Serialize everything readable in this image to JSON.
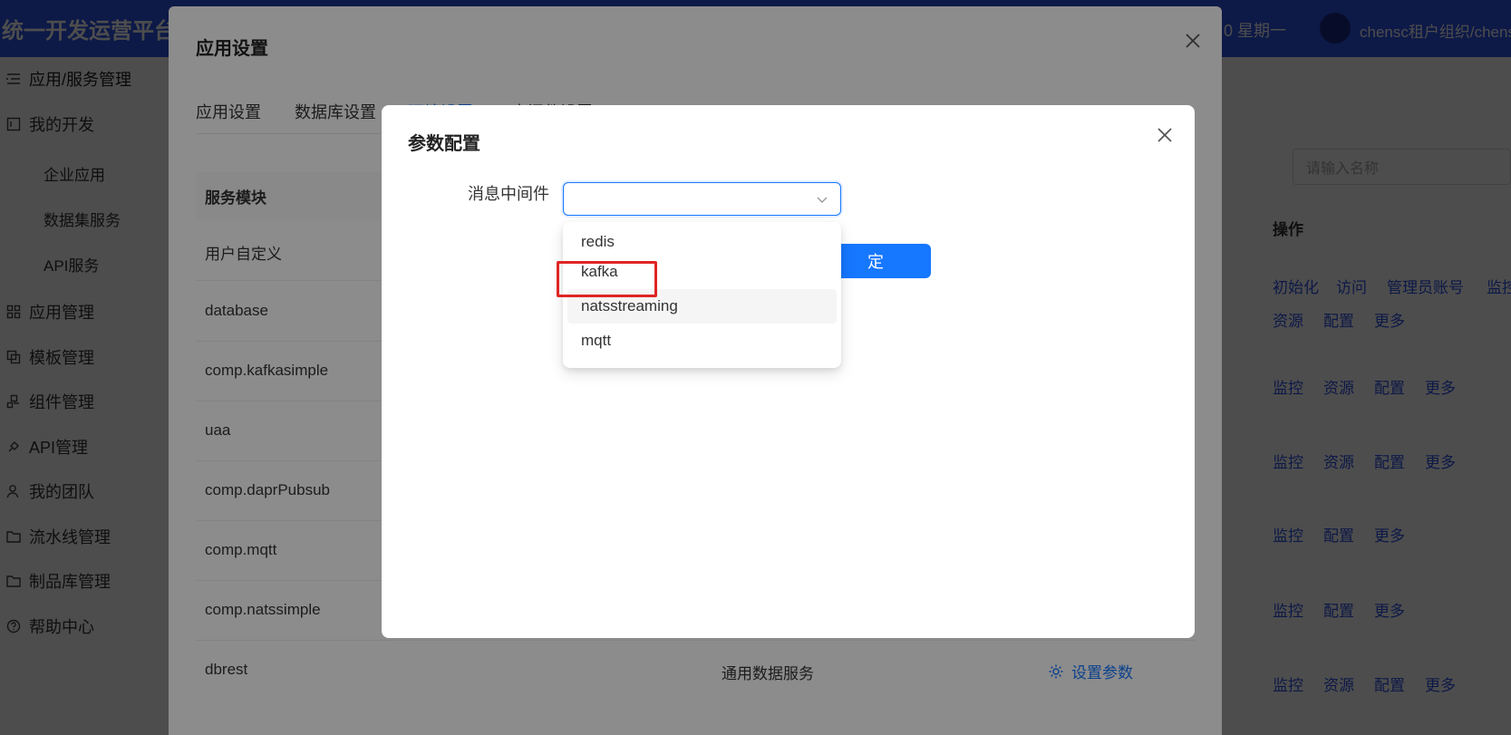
{
  "app": {
    "brand": "统一开发运营平台",
    "date_text": "0 星期一",
    "tenant": "chensc租户组织/chens"
  },
  "sidebar": {
    "items": [
      {
        "label": "应用/服务管理",
        "icon": "list-icon"
      },
      {
        "label": "我的开发",
        "icon": "dev-icon"
      },
      {
        "label": "应用管理",
        "icon": "grid-icon"
      },
      {
        "label": "模板管理",
        "icon": "template-icon"
      },
      {
        "label": "组件管理",
        "icon": "component-icon"
      },
      {
        "label": "API管理",
        "icon": "api-icon"
      },
      {
        "label": "我的团队",
        "icon": "team-icon"
      },
      {
        "label": "流水线管理",
        "icon": "folder-icon"
      },
      {
        "label": "制品库管理",
        "icon": "folder-icon"
      },
      {
        "label": "帮助中心",
        "icon": "help-icon"
      }
    ],
    "sub_items": [
      "企业应用",
      "数据集服务",
      "API服务"
    ]
  },
  "right": {
    "search_placeholder": "请输入名称",
    "ops_header": "操作",
    "rows": [
      [
        "初始化",
        "访问",
        "管理员账号",
        "监控"
      ],
      [
        "资源",
        "配置",
        "更多"
      ],
      [
        "监控",
        "资源",
        "配置",
        "更多"
      ],
      [
        "监控",
        "资源",
        "配置",
        "更多"
      ],
      [
        "监控",
        "配置",
        "更多"
      ],
      [
        "监控",
        "配置",
        "更多"
      ],
      [
        "监控",
        "资源",
        "配置",
        "更多"
      ]
    ]
  },
  "dialog1": {
    "title": "应用设置",
    "tabs": [
      "应用设置",
      "数据库设置",
      "环境设置",
      "中间件设置"
    ],
    "active_tab": 2,
    "table_header": "服务模块",
    "rows": [
      "用户自定义",
      "database",
      "comp.kafkasimple",
      "uaa",
      "comp.daprPubsub",
      "comp.mqtt",
      "comp.natssimple",
      "dbrest"
    ],
    "last_row_desc": "通用数据服务",
    "set_param": "设置参数"
  },
  "dialog2": {
    "title": "参数配置",
    "field_label": "消息中间件",
    "select_value": "",
    "ok_label": "定",
    "options": [
      "redis",
      "kafka",
      "natsstreaming",
      "mqtt"
    ]
  },
  "colors": {
    "topbar": "#2f54eb",
    "primary": "#1677ff",
    "highlight": "#e02424"
  }
}
